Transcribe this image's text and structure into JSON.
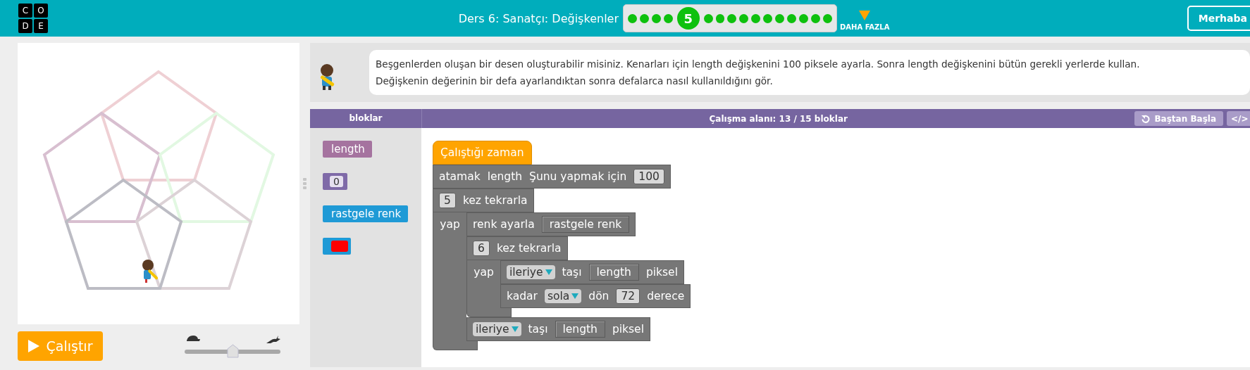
{
  "header": {
    "logo_letters": [
      "C",
      "O",
      "D",
      "E"
    ],
    "title": "Ders 6: Sanatçı: Değişkenler",
    "progress": [
      {
        "selected": false
      },
      {
        "selected": false
      },
      {
        "selected": false
      },
      {
        "selected": false
      },
      {
        "selected": true,
        "label": "5"
      },
      {
        "selected": false
      },
      {
        "selected": false
      },
      {
        "selected": false
      },
      {
        "selected": false
      },
      {
        "selected": false
      },
      {
        "selected": false
      },
      {
        "selected": false
      },
      {
        "selected": false
      },
      {
        "selected": false
      },
      {
        "selected": false
      },
      {
        "selected": false
      }
    ],
    "more_label": "DAHA FAZLA",
    "user_button": "Merhaba"
  },
  "stage": {
    "run_button": "Çalıştır",
    "speed": {
      "level": 0.5
    }
  },
  "instructions": {
    "lines": [
      "Beşgenlerden oluşan bir desen oluşturabilir misiniz. Kenarları için length değişkenini 100 piksele ayarla. Sonra length değişkenini bütün gerekli yerlerde kullan.",
      "Değişkenin değerinin bir defa ayarlandıktan sonra defalarca nasıl kullanıldığını gör."
    ]
  },
  "workspace": {
    "toolbox_title": "bloklar",
    "title": "Çalışma alanı: 13 / 15 bloklar",
    "reset_button": "Baştan Başla",
    "code_button": "</>"
  },
  "toolbox": [
    {
      "kind": "variable",
      "text": "length"
    },
    {
      "kind": "number",
      "text": "0"
    },
    {
      "kind": "value",
      "text": "rastgele renk"
    },
    {
      "kind": "colour",
      "color": "#ff0000"
    }
  ],
  "program": [
    {
      "kind": "event",
      "parts": [
        {
          "kind": "text",
          "text": "Çalıştığı zaman"
        }
      ]
    },
    {
      "kind": "statement",
      "parts": [
        {
          "kind": "text",
          "text": "atamak"
        },
        {
          "kind": "text",
          "text": "length"
        },
        {
          "kind": "text",
          "text": "Şunu yapmak için"
        },
        {
          "kind": "number",
          "text": "100"
        }
      ]
    },
    {
      "kind": "statement",
      "parts": [
        {
          "kind": "number",
          "text": "5"
        },
        {
          "kind": "text",
          "text": "kez tekrarla"
        }
      ],
      "body_label": "yap",
      "children": [
        {
          "kind": "statement",
          "parts": [
            {
              "kind": "text",
              "text": "renk ayarla"
            },
            {
              "kind": "reporter",
              "text": "rastgele renk"
            }
          ]
        },
        {
          "kind": "statement",
          "parts": [
            {
              "kind": "number",
              "text": "6"
            },
            {
              "kind": "text",
              "text": "kez tekrarla"
            }
          ],
          "body_label": "yap",
          "children": [
            {
              "kind": "statement",
              "parts": [
                {
                  "kind": "dropdown",
                  "text": "ileriye"
                },
                {
                  "kind": "text",
                  "text": "taşı"
                },
                {
                  "kind": "reporter",
                  "text": "length"
                },
                {
                  "kind": "text",
                  "text": "piksel"
                }
              ]
            },
            {
              "kind": "statement",
              "parts": [
                {
                  "kind": "text",
                  "text": "kadar"
                },
                {
                  "kind": "dropdown",
                  "text": "sola"
                },
                {
                  "kind": "text",
                  "text": "dön"
                },
                {
                  "kind": "number",
                  "text": "72"
                },
                {
                  "kind": "text",
                  "text": "derece"
                }
              ]
            }
          ]
        },
        {
          "kind": "statement",
          "parts": [
            {
              "kind": "dropdown",
              "text": "ileriye"
            },
            {
              "kind": "text",
              "text": "taşı"
            },
            {
              "kind": "reporter",
              "text": "length"
            },
            {
              "kind": "text",
              "text": "piksel"
            }
          ]
        }
      ]
    }
  ]
}
